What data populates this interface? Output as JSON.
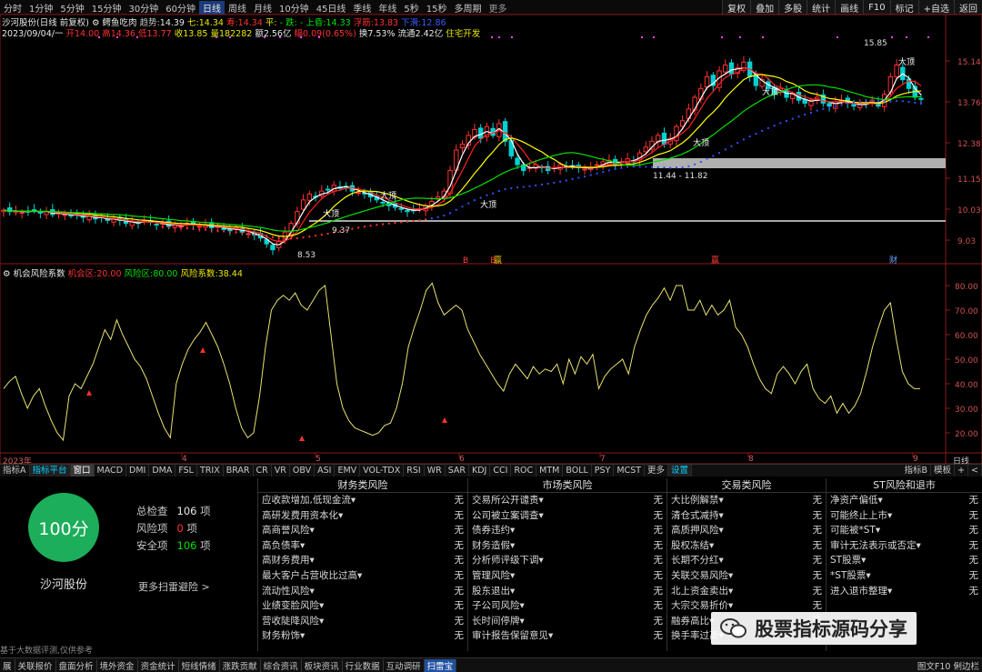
{
  "topbar": {
    "periods": [
      "分时",
      "1分钟",
      "5分钟",
      "15分钟",
      "30分钟",
      "60分钟",
      "日线",
      "周线",
      "月线",
      "10分钟",
      "45日线",
      "季线",
      "年线",
      "5秒",
      "15秒",
      "多周期",
      "更多"
    ],
    "active": "日线",
    "right_buttons": [
      "复权",
      "叠加",
      "多股",
      "统计",
      "画线",
      "F10",
      "标记",
      "+自选",
      "返回"
    ]
  },
  "info": {
    "stock_title": "沙河股份(日线 前复权)",
    "indicator": "鳄鱼吃肉",
    "trend_label": "趋势:",
    "trend_val": "14.39",
    "qi_label": "七:",
    "qi_val": "14.34",
    "shou_label": "寿:",
    "shou_val": "14.34",
    "ping_label": "平:",
    "ping_val": "",
    "die_label": "- 跌:",
    "shang_label": "- 上昏:",
    "shang_val": "14.33",
    "fu_label": "浮筋:",
    "fu_val": "13.83",
    "xiaqian_label": "下滑:",
    "xiaqian_val": "12.86",
    "date": "2023/09/04/一",
    "open_label": "开",
    "open_val": "14.00",
    "high_label": "高",
    "high_val": "14.36",
    "low_label": "低",
    "low_val": "13.77",
    "close_label": "收",
    "close_val": "13.85",
    "vol_label": "量",
    "vol_val": "182282",
    "amt_label": "额",
    "amt_val": "2.56亿",
    "chg_label": "幅",
    "chg_val": "0.09(0.65%)",
    "turn_label": "换",
    "turn_val": "7.53%",
    "float_label": "流通",
    "float_val": "2.42亿",
    "sector": "住宅开发"
  },
  "price_axis": [
    "15.14",
    "13.76",
    "12.38",
    "11.15",
    "10.03",
    "9.03"
  ],
  "annotations": {
    "high": "15.85",
    "low": "8.53",
    "box": "11.44 - 11.82",
    "mid": "9.37",
    "dd1": "大顶",
    "dd2": "大顶",
    "dd3": "大顶",
    "dd4": "大顶",
    "dd5": "大顶",
    "dd6": "大顶"
  },
  "event_markers": [
    "B",
    "B",
    "赢",
    "赢",
    "财"
  ],
  "indicator2": {
    "name": "机会风险系数",
    "chance_label": "机会区:",
    "chance_val": "20.00",
    "risk_label": "风险区:",
    "risk_val": "80.00",
    "coef_label": "风险系数:",
    "coef_val": "38.44"
  },
  "osc_axis": [
    "80.00",
    "70.00",
    "60.00",
    "50.00",
    "40.00",
    "30.00",
    "20.00"
  ],
  "date_axis": [
    "2023年",
    "4",
    "5",
    "6",
    "7",
    "8",
    "9"
  ],
  "date_axis_right": "日线",
  "tabs": [
    "指标A",
    "指标平台",
    "窗口",
    "MACD",
    "DMI",
    "DMA",
    "FSL",
    "TRIX",
    "BRAR",
    "CR",
    "VR",
    "OBV",
    "ASI",
    "EMV",
    "VOL-TDX",
    "RSI",
    "WR",
    "SAR",
    "KDJ",
    "CCI",
    "ROC",
    "MTM",
    "BOLL",
    "PSY",
    "MCST",
    "更多",
    "设置"
  ],
  "tabs_right": [
    "指标B",
    "模板",
    "+",
    "<"
  ],
  "score": {
    "value": "100分",
    "name": "沙河股份",
    "total_label": "总检查",
    "total": "106",
    "total_unit": "项",
    "risk_label": "风险项",
    "risk": "0",
    "risk_unit": "项",
    "safe_label": "安全项",
    "safe": "106",
    "safe_unit": "项",
    "more": "更多扫雷避险 >",
    "disclaimer": "基于大数据评测,仅供参考"
  },
  "columns": [
    {
      "title": "财务类风险",
      "items": [
        "应收款增加,低现金流",
        "高研发费用资本化",
        "高商誉风险",
        "高负债率",
        "高财务费用",
        "最大客户占营收比过高",
        "流动性风险",
        "业绩变脸风险",
        "营收陡降风险",
        "财务粉饰"
      ]
    },
    {
      "title": "市场类风险",
      "items": [
        "交易所公开谴责",
        "公司被立案调查",
        "债券违约",
        "财务造假",
        "分析师评级下调",
        "管理风险",
        "股东退出",
        "子公司风险",
        "长时间停牌",
        "审计报告保留意见"
      ]
    },
    {
      "title": "交易类风险",
      "items": [
        "大比例解禁",
        "清仓式减持",
        "高质押风险",
        "股权冻结",
        "长期不分红",
        "关联交易风险",
        "北上资金卖出",
        "大宗交易折价",
        "融券高比",
        "换手率过高"
      ]
    },
    {
      "title": "ST风险和退市",
      "items": [
        "净资产偏低",
        "可能终止上市",
        "可能被*ST",
        "审计无法表示或否定",
        "ST股票",
        "*ST股票",
        "进入退市整理"
      ]
    }
  ],
  "status_none": "无",
  "watermark": "股票指标源码分享",
  "bottombar": [
    "展",
    "关联报价",
    "盘面分析",
    "境外资金",
    "资金统计",
    "短线情绪",
    "涨跌贡献",
    "综合资讯",
    "板块资讯",
    "行业数据",
    "互动调研",
    "扫雷宝"
  ],
  "bottom_active": "扫雷宝",
  "bottom_right": "图文F10 俐边栏"
}
